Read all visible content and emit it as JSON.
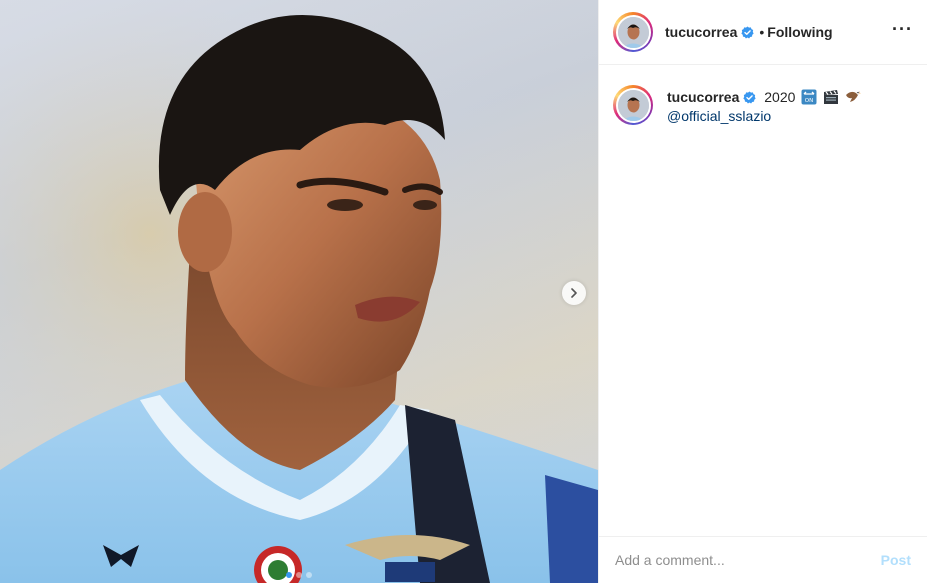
{
  "post": {
    "username": "tucucorrea",
    "verified": true,
    "follow_status": "Following",
    "separator": "•",
    "more_icon": "more-options-icon",
    "image": {
      "carousel": {
        "total": 3,
        "active_index": 1
      },
      "next_icon": "chevron-right-icon"
    }
  },
  "caption": {
    "username": "tucucorrea",
    "text": "2020",
    "emojis": [
      "on-arrow-emoji",
      "clapper-board-emoji",
      "eagle-emoji"
    ],
    "mention": "@official_sslazio"
  },
  "comment": {
    "placeholder": "Add a comment...",
    "post_label": "Post"
  },
  "colors": {
    "verified": "#3897f0",
    "mention": "#00376b",
    "post_disabled": "#b2dffc",
    "carousel_active": "#3897f0"
  }
}
